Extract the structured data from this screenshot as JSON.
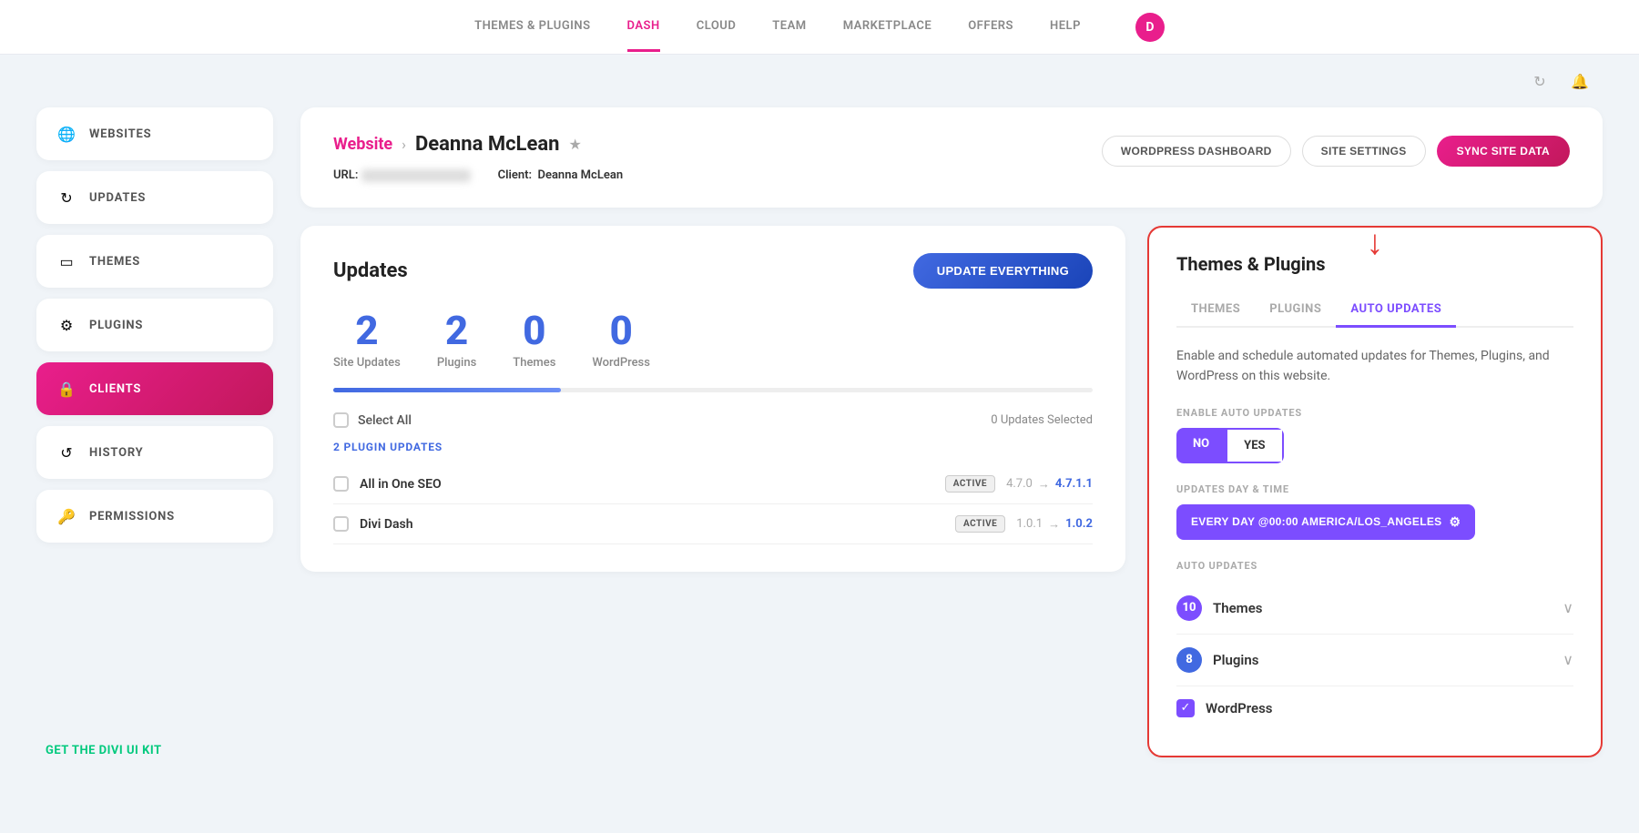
{
  "nav": {
    "items": [
      {
        "label": "THEMES & PLUGINS",
        "active": false
      },
      {
        "label": "DASH",
        "active": true
      },
      {
        "label": "CLOUD",
        "active": false
      },
      {
        "label": "TEAM",
        "active": false
      },
      {
        "label": "MARKETPLACE",
        "active": false
      },
      {
        "label": "OFFERS",
        "active": false
      },
      {
        "label": "HELP",
        "active": false
      }
    ],
    "avatar_letter": "D"
  },
  "sidebar": {
    "items": [
      {
        "id": "websites",
        "label": "WEBSITES",
        "icon": "🌐",
        "active": false
      },
      {
        "id": "updates",
        "label": "UPDATES",
        "icon": "↻",
        "active": false
      },
      {
        "id": "themes",
        "label": "THEMES",
        "icon": "▭",
        "active": false
      },
      {
        "id": "plugins",
        "label": "PLUGINS",
        "icon": "⚙",
        "active": false
      },
      {
        "id": "clients",
        "label": "CLIENTS",
        "icon": "🔒",
        "active": true
      },
      {
        "id": "history",
        "label": "HISTORY",
        "icon": "↺",
        "active": false
      },
      {
        "id": "permissions",
        "label": "PERMISSIONS",
        "icon": "🔑",
        "active": false
      }
    ],
    "get_kit_label": "GET THE DIVI UI KIT"
  },
  "header": {
    "breadcrumb_website": "Website",
    "breadcrumb_name": "Deanna McLean",
    "star": "★",
    "btn_wordpress": "WORDPRESS DASHBOARD",
    "btn_settings": "SITE SETTINGS",
    "btn_sync": "SYNC SITE DATA",
    "url_label": "URL:",
    "client_label": "Client:",
    "client_value": "Deanna McLean"
  },
  "updates_card": {
    "title": "Updates",
    "btn_update": "UPDATE EVERYTHING",
    "stats": [
      {
        "number": "2",
        "label": "Site Updates"
      },
      {
        "number": "2",
        "label": "Plugins"
      },
      {
        "number": "0",
        "label": "Themes"
      },
      {
        "number": "0",
        "label": "WordPress"
      }
    ],
    "progress_percent": 30,
    "select_all_label": "Select All",
    "updates_selected": "0 Updates Selected",
    "plugin_updates_label": "2 PLUGIN UPDATES",
    "plugins": [
      {
        "name": "All in One SEO",
        "status": "ACTIVE",
        "version_from": "4.7.0",
        "version_to": "4.7.1.1"
      },
      {
        "name": "Divi Dash",
        "status": "ACTIVE",
        "version_from": "1.0.1",
        "version_to": "1.0.2"
      }
    ]
  },
  "panel": {
    "title": "Themes & Plugins",
    "tabs": [
      {
        "label": "THEMES",
        "active": false
      },
      {
        "label": "PLUGINS",
        "active": false
      },
      {
        "label": "AUTO UPDATES",
        "active": true
      }
    ],
    "description": "Enable and schedule automated updates for Themes, Plugins, and WordPress on this website.",
    "enable_label": "ENABLE AUTO UPDATES",
    "toggle_no": "NO",
    "toggle_yes": "YES",
    "schedule_label": "UPDATES DAY & TIME",
    "schedule_value": "EVERY DAY @00:00  AMERICA/LOS_ANGELES",
    "auto_updates_label": "AUTO UPDATES",
    "auto_update_rows": [
      {
        "name": "Themes",
        "count": "10",
        "badge_class": "purple"
      },
      {
        "name": "Plugins",
        "count": "8",
        "badge_class": "blue"
      }
    ],
    "wordpress_label": "WordPress"
  }
}
